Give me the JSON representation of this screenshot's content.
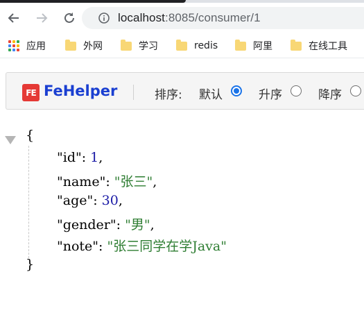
{
  "browser": {
    "url_host": "localhost",
    "url_rest": ":8085/consumer/1"
  },
  "bookmarks": [
    {
      "label": "应用",
      "icon": "apps-grid-icon"
    },
    {
      "label": "外网",
      "icon": "folder-icon"
    },
    {
      "label": "学习",
      "icon": "folder-icon"
    },
    {
      "label": "redis",
      "icon": "folder-icon"
    },
    {
      "label": "阿里",
      "icon": "folder-icon"
    },
    {
      "label": "在线工具",
      "icon": "folder-icon"
    }
  ],
  "fehelper": {
    "logo_text": "FE",
    "title": "FeHelper",
    "sort_label": "排序:",
    "options": [
      {
        "label": "默认",
        "checked": true
      },
      {
        "label": "升序",
        "checked": false
      },
      {
        "label": "降序",
        "checked": false
      }
    ]
  },
  "json_view": {
    "open_brace": "{",
    "close_brace": "}",
    "fields": [
      {
        "key": "\"id\"",
        "sep": ":  ",
        "value": "1",
        "type": "number",
        "trail": ","
      },
      {
        "key": "\"name\"",
        "sep": ":  ",
        "value": "\"张三\"",
        "type": "string",
        "trail": ","
      },
      {
        "key": "\"age\"",
        "sep": ":  ",
        "value": "30",
        "type": "number",
        "trail": ","
      },
      {
        "key": "\"gender\"",
        "sep": ":  ",
        "value": "\"男\"",
        "type": "string",
        "trail": ","
      },
      {
        "key": "\"note\"",
        "sep": ":  ",
        "value": "\"张三同学在学Java\"",
        "type": "string",
        "trail": ""
      }
    ]
  },
  "colors": {
    "brand_blue": "#1a3fd1",
    "number": "#1a1aa6",
    "string": "#2e7d32",
    "radio_active": "#1a73e8"
  }
}
